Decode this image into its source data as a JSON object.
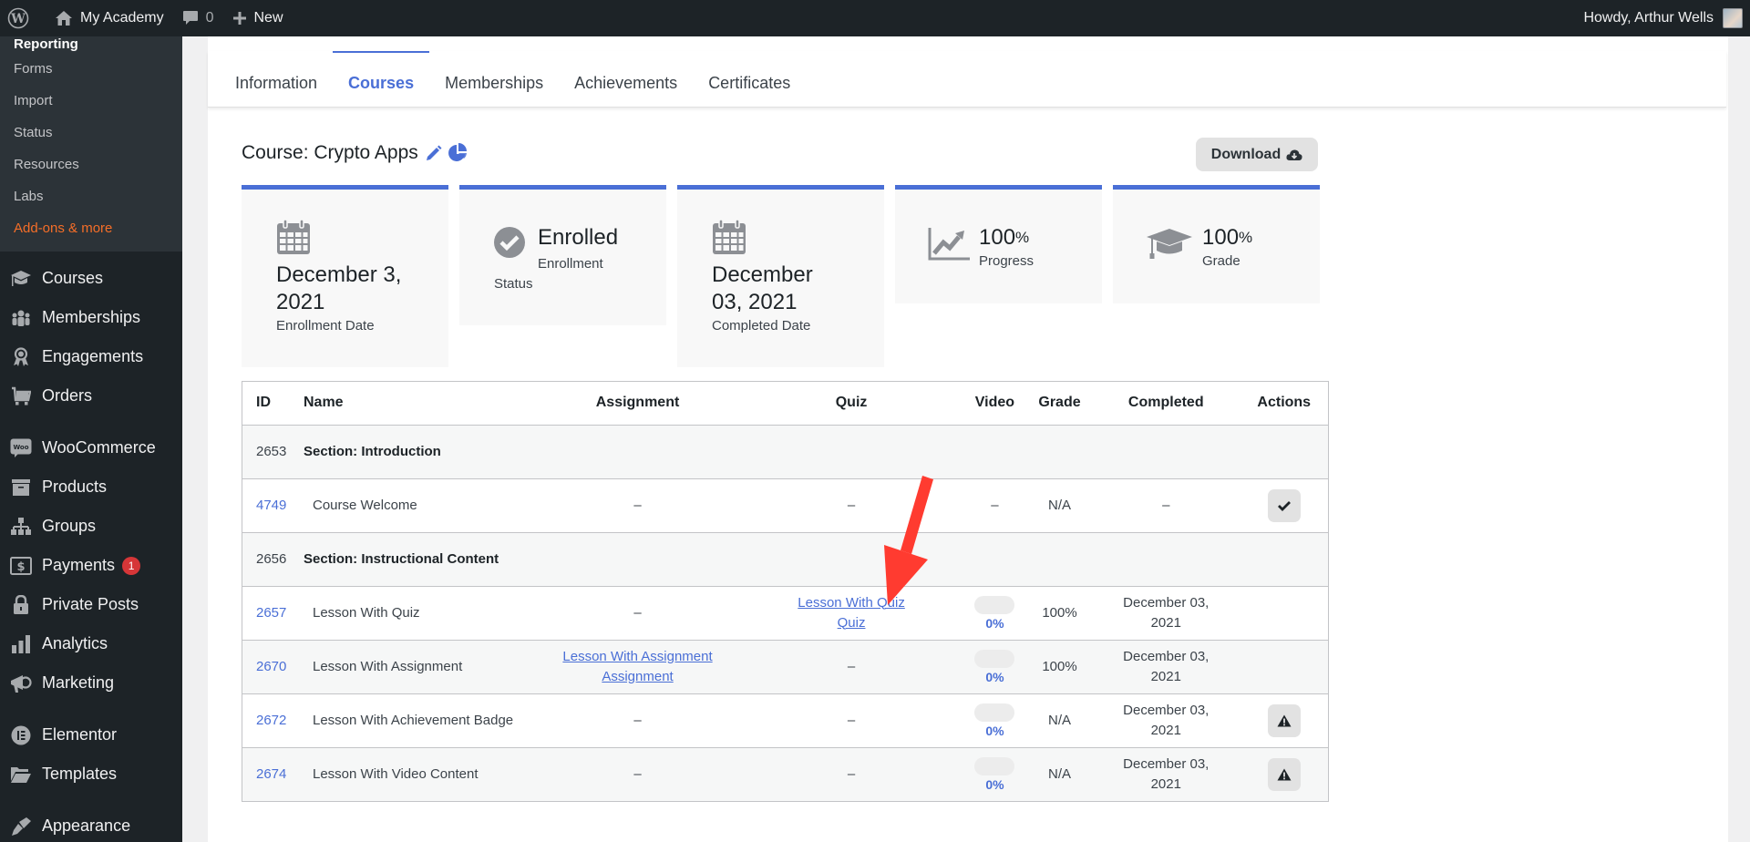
{
  "admin_bar": {
    "site_name": "My Academy",
    "comments_count": "0",
    "new_label": "New",
    "greeting": "Howdy, Arthur Wells"
  },
  "sidebar": {
    "submenu": [
      {
        "label": "Reporting",
        "current": true
      },
      {
        "label": "Forms"
      },
      {
        "label": "Import"
      },
      {
        "label": "Status"
      },
      {
        "label": "Resources"
      },
      {
        "label": "Labs"
      },
      {
        "label": "Add-ons & more",
        "highlight": true
      }
    ],
    "menu": [
      {
        "label": "Courses",
        "icon": "graduation-cap-icon"
      },
      {
        "label": "Memberships",
        "icon": "users-icon"
      },
      {
        "label": "Engagements",
        "icon": "award-icon"
      },
      {
        "label": "Orders",
        "icon": "cart-icon"
      },
      {
        "label": "WooCommerce",
        "icon": "woo-icon"
      },
      {
        "label": "Products",
        "icon": "archive-box-icon"
      },
      {
        "label": "Groups",
        "icon": "sitemap-icon"
      },
      {
        "label": "Payments",
        "icon": "dollar-icon",
        "badge": "1"
      },
      {
        "label": "Private Posts",
        "icon": "lock-icon"
      },
      {
        "label": "Analytics",
        "icon": "bar-chart-icon"
      },
      {
        "label": "Marketing",
        "icon": "megaphone-icon"
      },
      {
        "label": "Elementor",
        "icon": "elementor-icon"
      },
      {
        "label": "Templates",
        "icon": "folder-open-icon"
      },
      {
        "label": "Appearance",
        "icon": "paintbrush-icon"
      }
    ]
  },
  "tabs": [
    {
      "label": "Information"
    },
    {
      "label": "Courses",
      "active": true
    },
    {
      "label": "Memberships"
    },
    {
      "label": "Achievements"
    },
    {
      "label": "Certificates"
    }
  ],
  "course": {
    "title": "Course: Crypto Apps",
    "download_label": "Download"
  },
  "cards": {
    "enrollment_date": {
      "value": "December 3, 2021",
      "label": "Enrollment Date"
    },
    "status": {
      "value": "Enrolled",
      "label": "Enrollment Status"
    },
    "completed_date": {
      "value": "December 03, 2021",
      "label": "Completed Date"
    },
    "progress": {
      "value": "100",
      "unit": "%",
      "label": "Progress"
    },
    "grade": {
      "value": "100",
      "unit": "%",
      "label": "Grade"
    }
  },
  "table": {
    "headers": {
      "id": "ID",
      "name": "Name",
      "assignment": "Assignment",
      "quiz": "Quiz",
      "video": "Video",
      "grade": "Grade",
      "completed": "Completed",
      "actions": "Actions"
    },
    "rows": [
      {
        "type": "section",
        "id": "2653",
        "name": "Section: Introduction"
      },
      {
        "type": "lesson",
        "id": "4749",
        "name": "Course Welcome",
        "assignment": "–",
        "quiz": "–",
        "video": "–",
        "grade": "N/A",
        "completed": "–",
        "action": "check"
      },
      {
        "type": "section",
        "id": "2656",
        "name": "Section: Instructional Content"
      },
      {
        "type": "lesson",
        "id": "2657",
        "name": "Lesson With Quiz",
        "assignment": "–",
        "quiz_link": "Lesson With Quiz Quiz",
        "video_pct": "0%",
        "grade": "100%",
        "completed": "December 03, 2021",
        "action": ""
      },
      {
        "type": "lesson",
        "id": "2670",
        "name": "Lesson With Assignment",
        "assignment_link": "Lesson With Assignment Assignment",
        "quiz": "–",
        "video_pct": "0%",
        "grade": "100%",
        "completed": "December 03, 2021",
        "action": ""
      },
      {
        "type": "lesson",
        "id": "2672",
        "name": "Lesson With Achievement Badge",
        "assignment": "–",
        "quiz": "–",
        "video_pct": "0%",
        "grade": "N/A",
        "completed": "December 03, 2021",
        "action": "warning"
      },
      {
        "type": "lesson",
        "id": "2674",
        "name": "Lesson With Video Content",
        "assignment": "–",
        "quiz": "–",
        "video_pct": "0%",
        "grade": "N/A",
        "completed": "December 03, 2021",
        "action": "warning"
      }
    ]
  },
  "colors": {
    "accent": "#4a6fd6",
    "admin_bg": "#1d2327",
    "submenu_bg": "#2c3338",
    "highlight_orange": "#f56e28",
    "badge_red": "#d63638",
    "annotation_arrow": "#ff3b30"
  }
}
